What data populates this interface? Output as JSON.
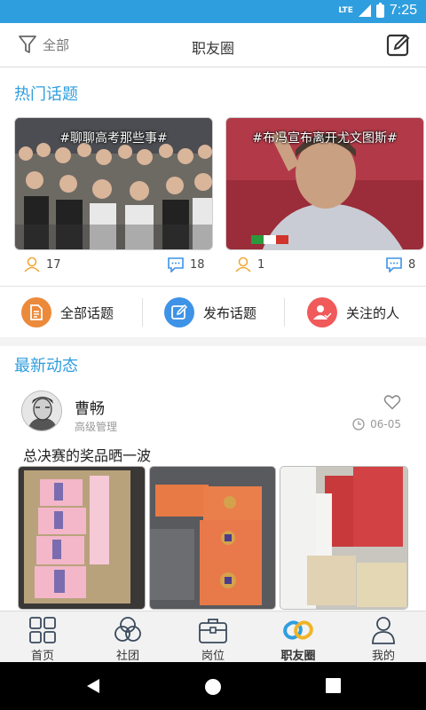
{
  "status_bar": {
    "network": "LTE",
    "time": "7:25"
  },
  "header": {
    "filter_label": "全部",
    "title": "职友圈"
  },
  "hot_topics": {
    "section_title": "热门话题",
    "items": [
      {
        "title": "#聊聊高考那些事#",
        "participants": "17",
        "comments": "18"
      },
      {
        "title": "#布冯宣布离开尤文图斯#",
        "participants": "1",
        "comments": "8"
      }
    ]
  },
  "actions": [
    {
      "label": "全部话题",
      "color": "#ec8a3b",
      "icon": "document-icon"
    },
    {
      "label": "发布话题",
      "color": "#3e93e6",
      "icon": "edit-icon"
    },
    {
      "label": "关注的人",
      "color": "#f05a5a",
      "icon": "follow-user-icon"
    }
  ],
  "latest": {
    "section_title": "最新动态",
    "post": {
      "author": "曹畅",
      "role": "高级管理",
      "date": "06-05",
      "text": "总决赛的奖品晒一波"
    }
  },
  "bottom_nav": [
    {
      "label": "首页",
      "icon": "home-grid-icon"
    },
    {
      "label": "社团",
      "icon": "club-icon"
    },
    {
      "label": "岗位",
      "icon": "briefcase-icon"
    },
    {
      "label": "职友圈",
      "icon": "friend-circle-icon",
      "active": true
    },
    {
      "label": "我的",
      "icon": "profile-icon"
    }
  ],
  "colors": {
    "accent": "#2f9ede",
    "status_bar": "#2f9ede"
  }
}
